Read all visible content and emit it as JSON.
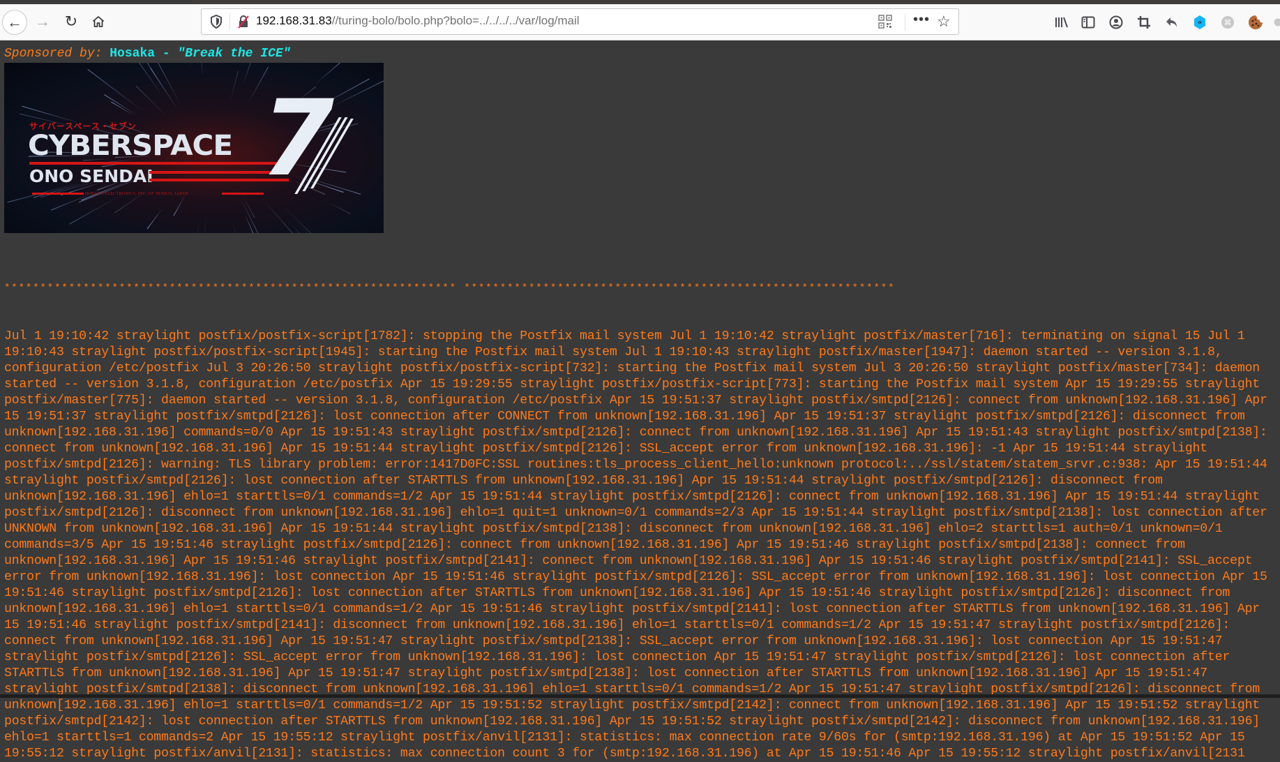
{
  "browser": {
    "url_host": "192.168.31.83",
    "url_path": "//turing-bolo/bolo.php?bolo=../../../../var/log/mail",
    "nav": {
      "back_icon": "arrow-left-icon",
      "forward_icon": "arrow-right-icon",
      "reload_icon": "reload-icon",
      "home_icon": "home-icon"
    },
    "urlbar_icons": [
      "tracking-shield-icon",
      "insecure-lock-icon",
      "qr-code-icon",
      "more-actions-icon",
      "bookmark-star-icon"
    ],
    "toolbar_icons": [
      "library-icon",
      "sidebar-icon",
      "account-icon",
      "crop-icon",
      "undo-icon",
      "extension-blue-icon",
      "extension-command-icon",
      "cookie-icon",
      "extension-gray-icon"
    ]
  },
  "page": {
    "sponsor_label": "Sponsored by:",
    "sponsor_name": "Hosaka - ",
    "sponsor_quote": "\"Break the ICE\"",
    "banner": {
      "jp_text": "サイバースペース・セブン",
      "title": "CYBERSPACE",
      "number": "7",
      "subtitle": "ONO SENDAI",
      "company": "HOSAKA ELECTRONICS, INC. OF SENDAI, JAPAN"
    },
    "separator": "*************************************************************** ************************************************************",
    "log_lines": [
      "Jul 1 19:10:42 straylight postfix/postfix-script[1782]: stopping the Postfix mail system Jul 1 19:10:42 straylight postfix/master[716]: terminating on signal 15 Jul 1",
      "19:10:43 straylight postfix/postfix-script[1945]: starting the Postfix mail system Jul 1 19:10:43 straylight postfix/master[1947]: daemon started -- version 3.1.8,",
      "configuration /etc/postfix Jul 3 20:26:50 straylight postfix/postfix-script[732]: starting the Postfix mail system Jul 3 20:26:50 straylight postfix/master[734]: daemon",
      "started -- version 3.1.8, configuration /etc/postfix Apr 15 19:29:55 straylight postfix/postfix-script[773]: starting the Postfix mail system Apr 15 19:29:55 straylight",
      "postfix/master[775]: daemon started -- version 3.1.8, configuration /etc/postfix Apr 15 19:51:37 straylight postfix/smtpd[2126]: connect from unknown[192.168.31.196] Apr",
      "15 19:51:37 straylight postfix/smtpd[2126]: lost connection after CONNECT from unknown[192.168.31.196] Apr 15 19:51:37 straylight postfix/smtpd[2126]: disconnect from",
      "unknown[192.168.31.196] commands=0/0 Apr 15 19:51:43 straylight postfix/smtpd[2126]: connect from unknown[192.168.31.196] Apr 15 19:51:43 straylight postfix/smtpd[2138]:",
      "connect from unknown[192.168.31.196] Apr 15 19:51:44 straylight postfix/smtpd[2126]: SSL_accept error from unknown[192.168.31.196]: -1 Apr 15 19:51:44 straylight",
      "postfix/smtpd[2126]: warning: TLS library problem: error:1417D0FC:SSL routines:tls_process_client_hello:unknown protocol:../ssl/statem/statem_srvr.c:938: Apr 15 19:51:44",
      "straylight postfix/smtpd[2126]: lost connection after STARTTLS from unknown[192.168.31.196] Apr 15 19:51:44 straylight postfix/smtpd[2126]: disconnect from",
      "unknown[192.168.31.196] ehlo=1 starttls=0/1 commands=1/2 Apr 15 19:51:44 straylight postfix/smtpd[2126]: connect from unknown[192.168.31.196] Apr 15 19:51:44 straylight",
      "postfix/smtpd[2126]: disconnect from unknown[192.168.31.196] ehlo=1 quit=1 unknown=0/1 commands=2/3 Apr 15 19:51:44 straylight postfix/smtpd[2138]: lost connection after",
      "UNKNOWN from unknown[192.168.31.196] Apr 15 19:51:44 straylight postfix/smtpd[2138]: disconnect from unknown[192.168.31.196] ehlo=2 starttls=1 auth=0/1 unknown=0/1",
      "commands=3/5 Apr 15 19:51:46 straylight postfix/smtpd[2126]: connect from unknown[192.168.31.196] Apr 15 19:51:46 straylight postfix/smtpd[2138]: connect from",
      "unknown[192.168.31.196] Apr 15 19:51:46 straylight postfix/smtpd[2141]: connect from unknown[192.168.31.196] Apr 15 19:51:46 straylight postfix/smtpd[2141]: SSL_accept",
      "error from unknown[192.168.31.196]: lost connection Apr 15 19:51:46 straylight postfix/smtpd[2126]: SSL_accept error from unknown[192.168.31.196]: lost connection Apr 15",
      "19:51:46 straylight postfix/smtpd[2126]: lost connection after STARTTLS from unknown[192.168.31.196] Apr 15 19:51:46 straylight postfix/smtpd[2126]: disconnect from",
      "unknown[192.168.31.196] ehlo=1 starttls=0/1 commands=1/2 Apr 15 19:51:46 straylight postfix/smtpd[2141]: lost connection after STARTTLS from unknown[192.168.31.196] Apr",
      "15 19:51:46 straylight postfix/smtpd[2141]: disconnect from unknown[192.168.31.196] ehlo=1 starttls=0/1 commands=1/2 Apr 15 19:51:47 straylight postfix/smtpd[2126]:",
      "connect from unknown[192.168.31.196] Apr 15 19:51:47 straylight postfix/smtpd[2138]: SSL_accept error from unknown[192.168.31.196]: lost connection Apr 15 19:51:47",
      "straylight postfix/smtpd[2126]: SSL_accept error from unknown[192.168.31.196]: lost connection Apr 15 19:51:47 straylight postfix/smtpd[2126]: lost connection after",
      "STARTTLS from unknown[192.168.31.196] Apr 15 19:51:47 straylight postfix/smtpd[2138]: lost connection after STARTTLS from unknown[192.168.31.196] Apr 15 19:51:47",
      "straylight postfix/smtpd[2138]: disconnect from unknown[192.168.31.196] ehlo=1 starttls=0/1 commands=1/2 Apr 15 19:51:47 straylight postfix/smtpd[2126]: disconnect from",
      "unknown[192.168.31.196] ehlo=1 starttls=0/1 commands=1/2 Apr 15 19:51:52 straylight postfix/smtpd[2142]: connect from unknown[192.168.31.196] Apr 15 19:51:52 straylight",
      "postfix/smtpd[2142]: lost connection after STARTTLS from unknown[192.168.31.196] Apr 15 19:51:52 straylight postfix/smtpd[2142]: disconnect from unknown[192.168.31.196]",
      "ehlo=1 starttls=1 commands=2 Apr 15 19:55:12 straylight postfix/anvil[2131]: statistics: max connection rate 9/60s for (smtp:192.168.31.196) at Apr 15 19:51:52 Apr 15",
      "19:55:12 straylight postfix/anvil[2131]: statistics: max connection count 3 for (smtp:192.168.31.196) at Apr 15 19:51:46 Apr 15 19:55:12 straylight postfix/anvil[2131"
    ]
  },
  "colors": {
    "background": "#3a3a3a",
    "log_text": "#ff7a1a",
    "sponsor_accent": "#1ee6e6"
  }
}
